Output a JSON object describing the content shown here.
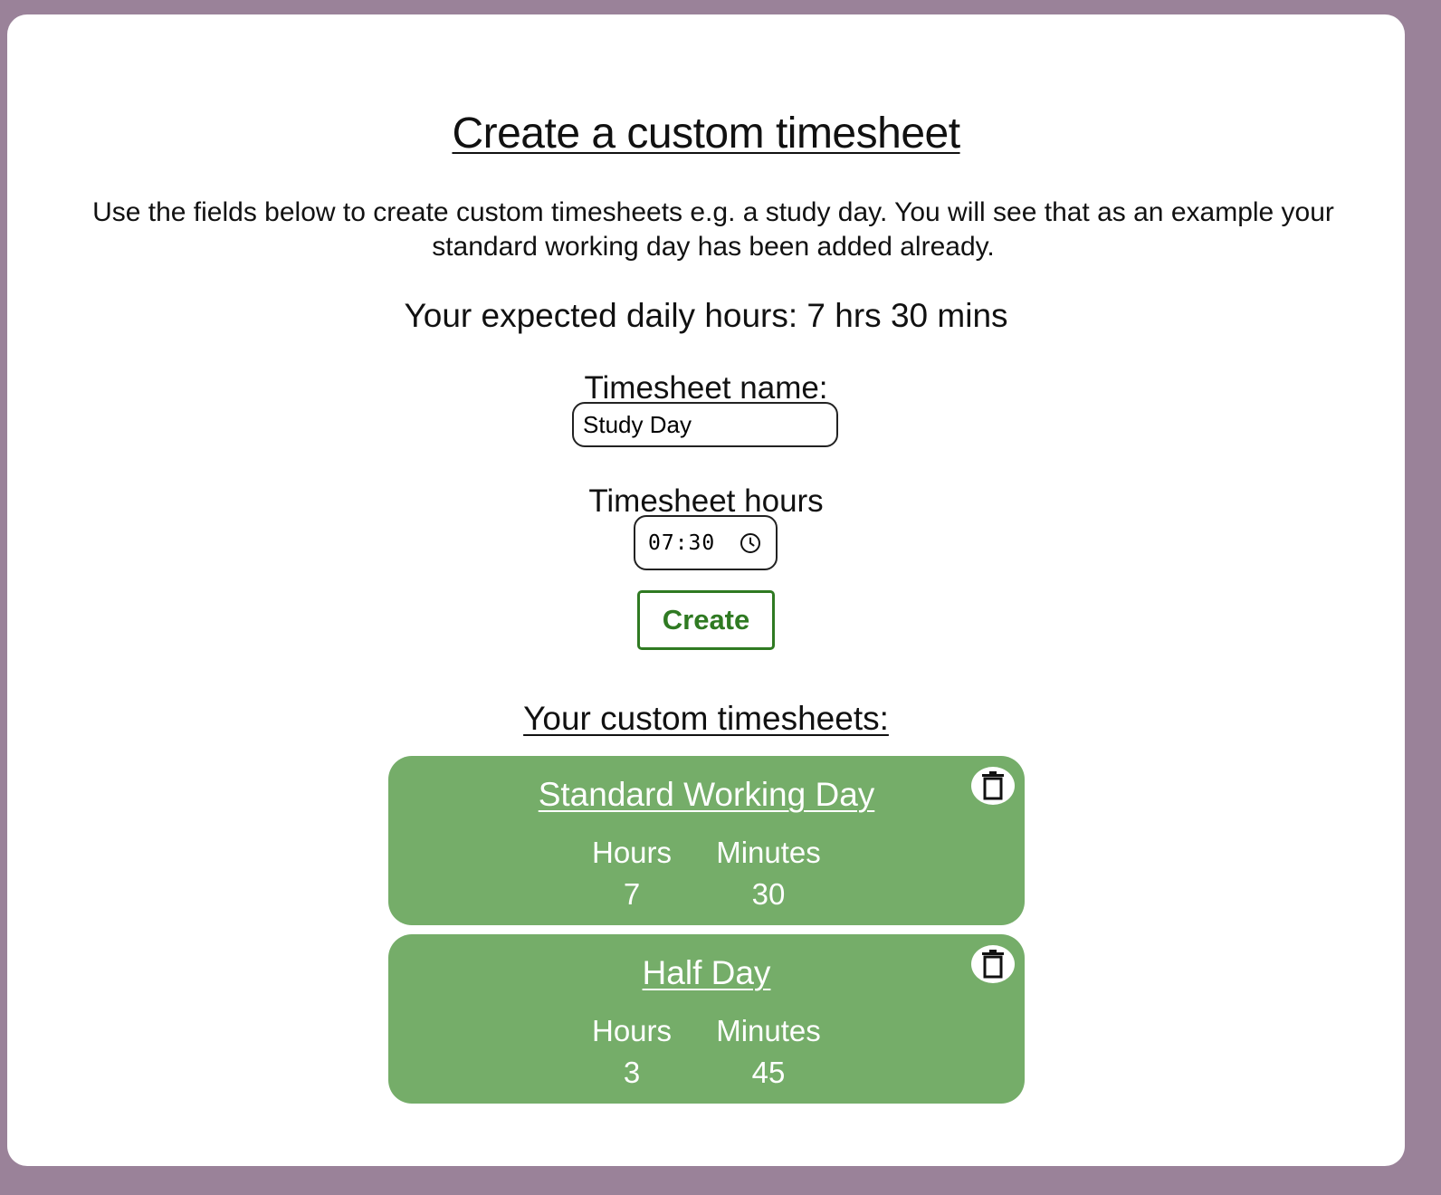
{
  "header": {
    "title": "Create a custom timesheet",
    "intro": "Use the fields below to create custom timesheets e.g. a study day. You will see that as an example your standard working day has been added already.",
    "expected_hours": "Your expected daily hours: 7 hrs 30 mins"
  },
  "form": {
    "name_label": "Timesheet name:",
    "name_value": "Study Day",
    "hours_label": "Timesheet hours",
    "hours_value": "07:30",
    "create_label": "Create"
  },
  "list": {
    "heading": "Your custom timesheets:",
    "items": [
      {
        "name": "Standard Working Day",
        "hours_label": "Hours",
        "minutes_label": "Minutes",
        "hours": "7",
        "minutes": "30"
      },
      {
        "name": "Half Day",
        "hours_label": "Hours",
        "minutes_label": "Minutes",
        "hours": "3",
        "minutes": "45"
      }
    ]
  },
  "icons": {
    "time": "clock-icon",
    "delete": "trash-icon"
  },
  "colors": {
    "background": "#9a8299",
    "card_green": "#75ad69",
    "create_green": "#2f7a22"
  }
}
